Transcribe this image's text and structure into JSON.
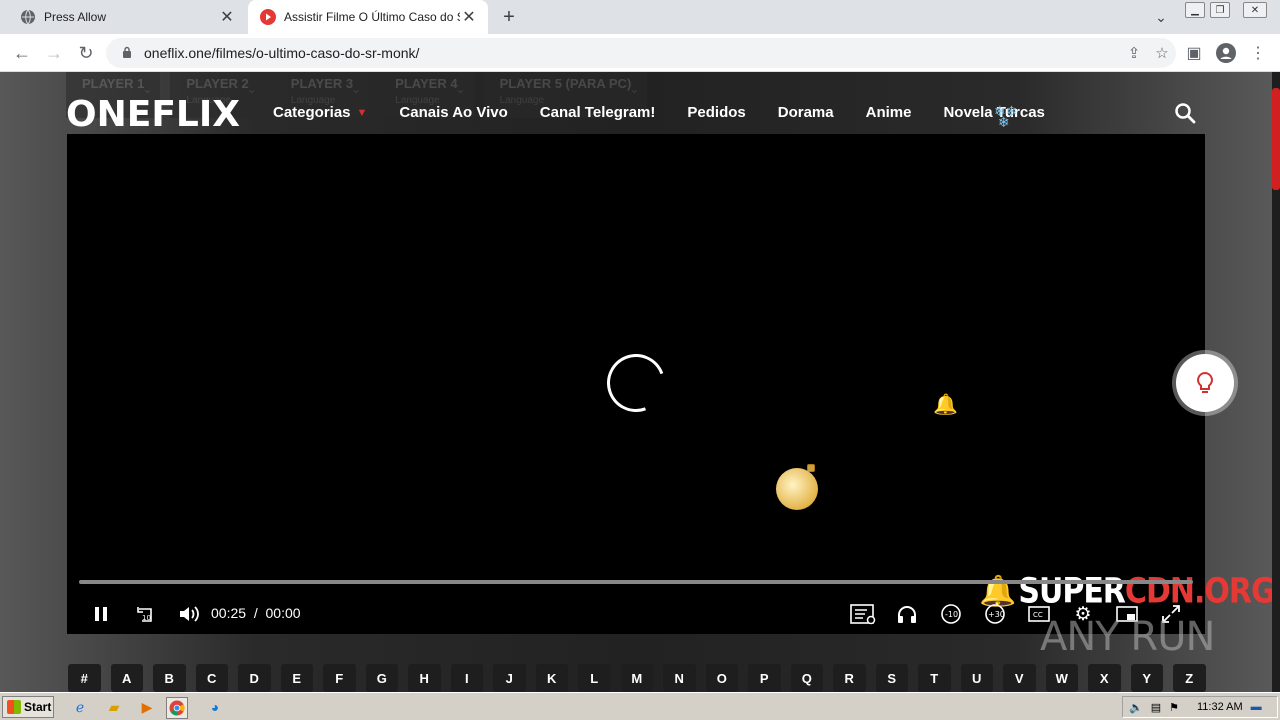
{
  "browser": {
    "tabs": [
      {
        "title": "Press Allow",
        "active": false
      },
      {
        "title": "Assistir Filme O Último Caso do Sr. M",
        "active": true
      }
    ],
    "url": "oneflix.one/filmes/o-ultimo-caso-do-sr-monk/"
  },
  "site": {
    "logo": "ONEFLIX",
    "players": [
      {
        "name": "PLAYER 1",
        "lang": ""
      },
      {
        "name": "PLAYER 2",
        "lang": "Language"
      },
      {
        "name": "PLAYER 3",
        "lang": "Language"
      },
      {
        "name": "PLAYER 4",
        "lang": "Language"
      },
      {
        "name": "PLAYER 5 (PARA PC)",
        "lang": "Language"
      }
    ],
    "nav": [
      "Categorias",
      "Canais Ao Vivo",
      "Canal Telegram!",
      "Pedidos",
      "Dorama",
      "Anime",
      "Novela Turcas"
    ]
  },
  "player": {
    "current_time": "00:25",
    "separator": "/",
    "duration": "00:00",
    "watermark_main": "SUPER",
    "watermark_accent": "CDN.ORG",
    "state": "loading"
  },
  "alphabet": [
    "#",
    "A",
    "B",
    "C",
    "D",
    "E",
    "F",
    "G",
    "H",
    "I",
    "J",
    "K",
    "L",
    "M",
    "N",
    "O",
    "P",
    "Q",
    "R",
    "S",
    "T",
    "U",
    "V",
    "W",
    "X",
    "Y",
    "Z"
  ],
  "overlay": {
    "anyrun": "ANY RUN"
  },
  "taskbar": {
    "start": "Start",
    "clock": "11:32 AM"
  },
  "colors": {
    "accent_red": "#d32f2f",
    "page_bg": "#2a2a2a"
  }
}
